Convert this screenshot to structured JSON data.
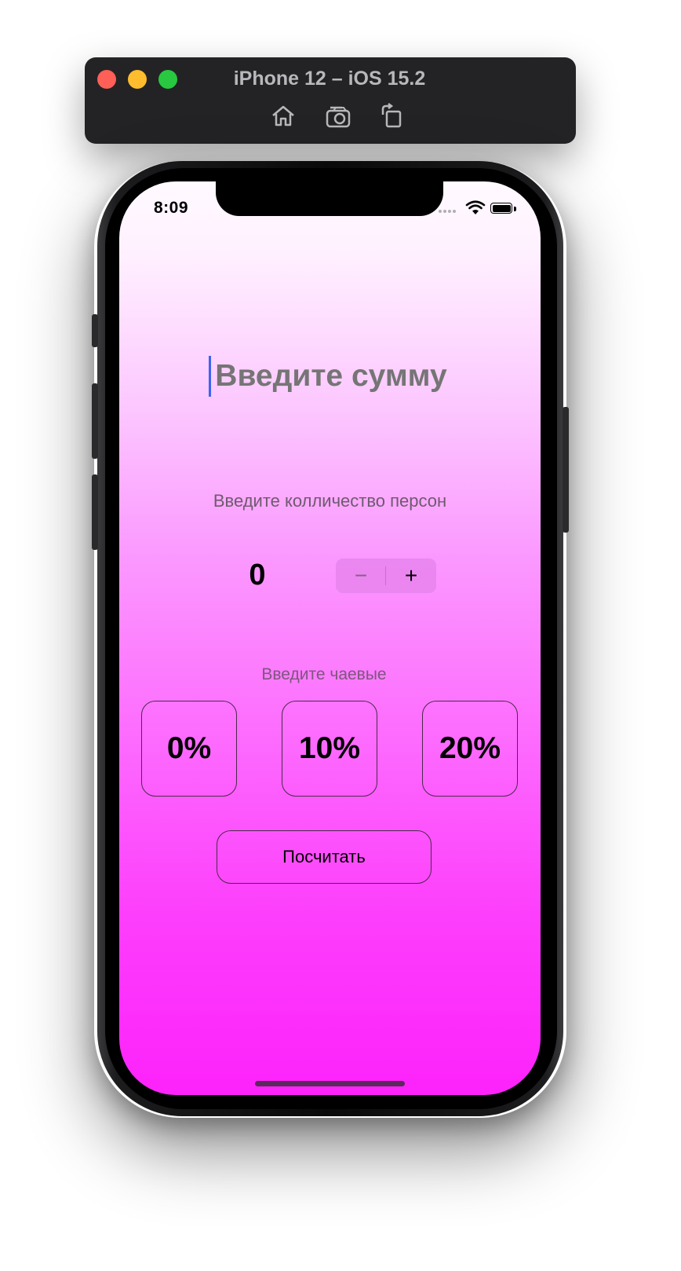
{
  "simulator": {
    "title": "iPhone 12 – iOS 15.2",
    "toolbar": [
      "home-icon",
      "screenshot-icon",
      "rotate-icon"
    ]
  },
  "status_bar": {
    "time": "8:09",
    "icons": [
      "cellular-dots-icon",
      "wifi-icon",
      "battery-icon"
    ]
  },
  "app": {
    "amount_placeholder": "Введите сумму",
    "amount_value": "",
    "persons_label": "Введите колличество персон",
    "persons_value": "0",
    "stepper": {
      "minus": "−",
      "plus": "+"
    },
    "tips_label": "Введите чаевые",
    "tips": [
      "0%",
      "10%",
      "20%"
    ],
    "calculate_label": "Посчитать"
  },
  "colors": {
    "gradient_top": "#fffaff",
    "gradient_bottom": "#fd22fb",
    "caret": "#3c64f0",
    "placeholder": "#c596c6"
  }
}
